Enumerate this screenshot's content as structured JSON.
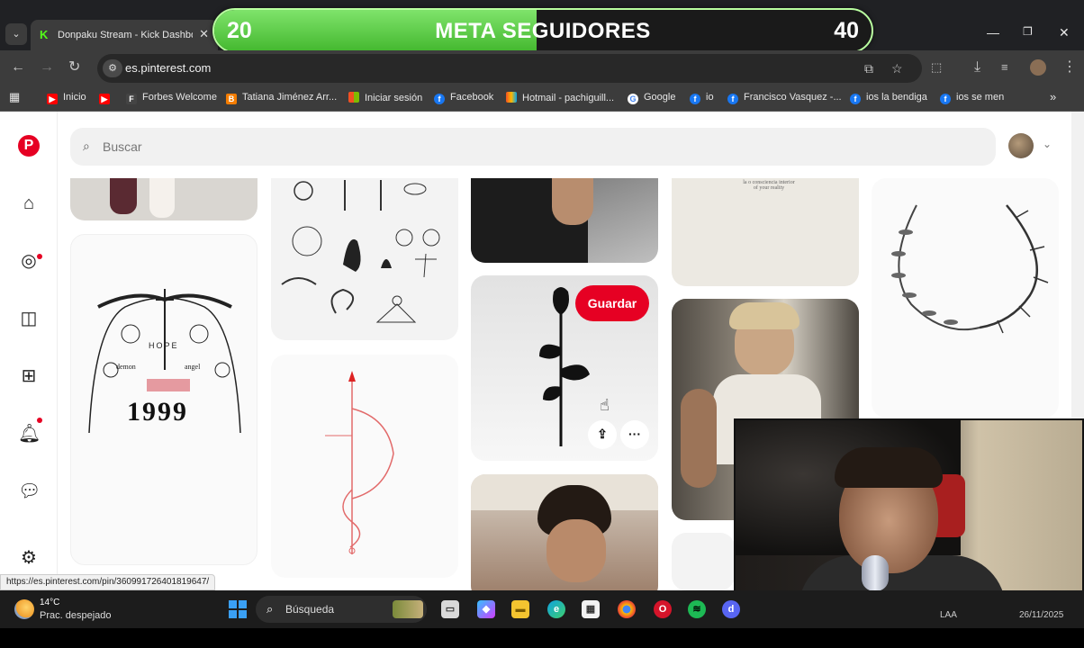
{
  "browser": {
    "tab_title": "Donpaku Stream - Kick Dashboard",
    "tab_close": "✕",
    "url": "es.pinterest.com",
    "window_controls": [
      "—",
      "❐",
      "✕"
    ]
  },
  "overlay": {
    "left_value": "20",
    "title": "META SEGUIDORES",
    "right_value": "40",
    "progress_fraction": 0.49
  },
  "bookmarks": [
    {
      "label": "Inicio",
      "icon": "youtube-icon",
      "color": "#ff0000"
    },
    {
      "label": "",
      "icon": "youtube-icon",
      "color": "#ff0000"
    },
    {
      "label": "Forbes Welcome",
      "icon": "forbes-icon",
      "color": "#555555"
    },
    {
      "label": "Tatiana Jiménez Arr...",
      "icon": "blogger-icon",
      "color": "#f57d00"
    },
    {
      "label": "Iniciar sesión",
      "icon": "microsoft-icon",
      "color": "#f25022"
    },
    {
      "label": "Facebook",
      "icon": "facebook-icon",
      "color": "#1877f2"
    },
    {
      "label": "Hotmail - pachiguill...",
      "icon": "msn-icon",
      "color": "#f25022"
    },
    {
      "label": "Google",
      "icon": "google-icon",
      "color": "#ffffff"
    },
    {
      "label": "io",
      "icon": "facebook-icon",
      "color": "#1877f2"
    },
    {
      "label": "Francisco Vasquez -...",
      "icon": "facebook-icon",
      "color": "#1877f2"
    },
    {
      "label": "ios la bendiga",
      "icon": "facebook-icon",
      "color": "#1877f2"
    },
    {
      "label": "ios se men",
      "icon": "facebook-icon",
      "color": "#1877f2"
    }
  ],
  "pinterest": {
    "search_placeholder": "Buscar",
    "save_label": "Guardar",
    "more_label": "···",
    "paper_text": "la o consciencia interior\nof your reality",
    "tattoo_texts": {
      "hope": "HOPE",
      "demon": "demon",
      "angel": "angel",
      "year": "1999"
    }
  },
  "status_url": "https://es.pinterest.com/pin/360991726401819647/",
  "taskbar": {
    "temperature": "14°C",
    "weather": "Prac. despejado",
    "search_label": "Búsqueda",
    "language": "LAA",
    "date": "26/11/2025"
  },
  "colors": {
    "pinterest_red": "#e60023",
    "overlay_green": "#44b82f",
    "chrome_dark": "#3c3c3c"
  }
}
